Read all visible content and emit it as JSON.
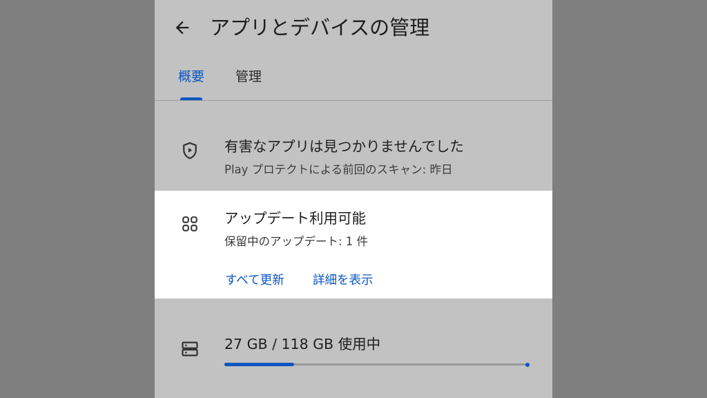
{
  "header": {
    "title": "アプリとデバイスの管理",
    "back_icon": "arrow-left-icon"
  },
  "tabs": [
    {
      "label": "概要",
      "selected": true
    },
    {
      "label": "管理",
      "selected": false
    }
  ],
  "protect": {
    "icon": "shield-play-icon",
    "title": "有害なアプリは見つかりませんでした",
    "subtitle": "Play プロテクトによる前回のスキャン: 昨日"
  },
  "updates": {
    "icon": "apps-grid-icon",
    "title": "アップデート利用可能",
    "subtitle": "保留中のアップデート: 1 件",
    "update_all_label": "すべて更新",
    "details_label": "詳細を表示"
  },
  "storage": {
    "icon": "storage-icon",
    "usage_text": "27 GB / 118 GB 使用中",
    "used_fraction": 0.229
  },
  "colors": {
    "accent": "#0b57c2",
    "dim_background": "#c2c2c2",
    "outer_background": "#7f7f7f",
    "card_highlight": "#ffffff"
  }
}
